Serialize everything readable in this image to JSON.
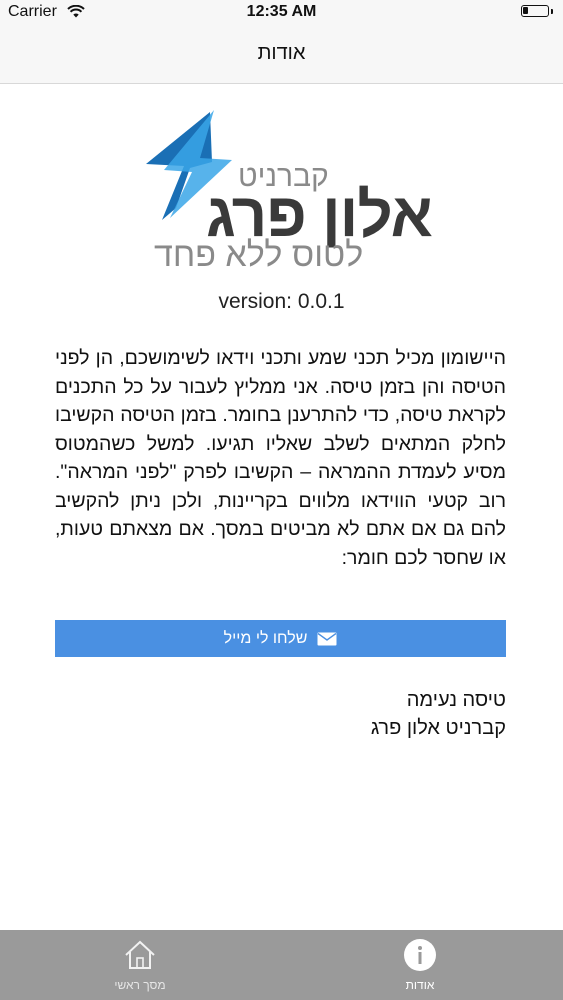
{
  "status_bar": {
    "carrier": "Carrier",
    "time": "12:35 AM",
    "battery_fraction": 0.2
  },
  "nav": {
    "title": "אודות"
  },
  "logo": {
    "kicker": "קברניט",
    "name": "אלון פרג",
    "slogan": "לטוס ללא פחד",
    "colors": {
      "bolt_dark": "#1a6fb5",
      "bolt_light": "#3aa6e8",
      "text_dark": "#3a3a3a",
      "text_gray": "#8a8a8a"
    }
  },
  "version": "version: 0.0.1",
  "description": "היישומון מכיל תכני שמע ותכני וידאו לשימושכם, הן לפני הטיסה והן בזמן טיסה. אני ממליץ לעבור על כל התכנים לקראת טיסה, כדי להתרענן בחומר. בזמן הטיסה הקשיבו לחלק המתאים לשלב שאליו תגיעו. למשל כשהמטוס מסיע לעמדת ההמראה – הקשיבו לפרק \"לפני המראה\". רוב קטעי הווידאו מלווים בקריינות, ולכן ניתן להקשיב להם גם אם אתם לא מביטים במסך. אם מצאתם טעות, או שחסר לכם חומר:",
  "mail_button": {
    "label": "שלחו לי מייל",
    "icon": "envelope-icon",
    "color": "#4a90e2"
  },
  "signoff": {
    "line1": "טיסה נעימה",
    "line2": "קברניט אלון פרג"
  },
  "tab_bar": {
    "background": "#9a9a9a",
    "tabs": [
      {
        "label": "מסך ראשי",
        "icon": "home-icon"
      },
      {
        "label": "אודות",
        "icon": "info-icon"
      }
    ]
  }
}
